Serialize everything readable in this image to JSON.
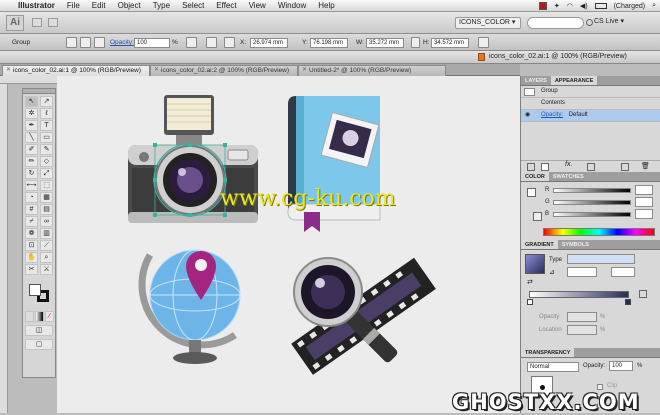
{
  "menubar": {
    "app_name": "Illustrator",
    "items": [
      "File",
      "Edit",
      "Object",
      "Type",
      "Select",
      "Effect",
      "View",
      "Window",
      "Help"
    ],
    "battery": "(Charged)"
  },
  "appbar": {
    "logo": "Ai",
    "workspace": "ICONS_COLOR ▾",
    "cs_live": "CS Live ▾"
  },
  "control": {
    "selection_label": "Group",
    "opacity_label": "Opacity:",
    "opacity_value": "100",
    "opacity_unit": "%",
    "x_label": "X:",
    "x_value": "26.974 mm",
    "y_label": "Y:",
    "y_value": "76.198 mm",
    "w_label": "W:",
    "w_value": "35.272 mm",
    "h_label": "H:",
    "h_value": "34.572 mm"
  },
  "document": {
    "title": "icons_color_02.ai:1 @ 100% (RGB/Preview)",
    "tabs": [
      {
        "label": "icons_color_02.ai:1 @ 100% (RGB/Preview)",
        "active": true
      },
      {
        "label": "icons_color_02.ai:2 @ 100% (RGB/Preview)",
        "active": false
      },
      {
        "label": "Untitled-2* @ 100% (RGB/Preview)",
        "active": false
      }
    ]
  },
  "panels": {
    "layers_tab": "LAYERS",
    "appearance_tab": "APPEARANCE",
    "appearance_rows": [
      "Group",
      "Contents"
    ],
    "appearance_opacity_label": "Opacity:",
    "appearance_opacity_value": "Default",
    "color_tab": "COLOR",
    "swatches_tab": "SWATCHES",
    "color_channels": [
      "R",
      "G",
      "B"
    ],
    "gradient_tab": "GRADIENT",
    "symbols_tab": "SYMBOLS",
    "gradient_type_label": "Type",
    "gradient_opacity_label": "Opacity",
    "gradient_location_label": "Location",
    "percent": "%",
    "transparency_tab": "TRANSPARENCY",
    "blend_mode": "Normal",
    "transparency_opacity_label": "Opacity:",
    "transparency_opacity_value": "100",
    "clip_label": "Clip"
  },
  "watermarks": {
    "center": "www.cg-ku.com",
    "corner": "GHOSTXX.COM"
  },
  "colors": {
    "selection": "#3bb0a0",
    "book_blue": "#7cc7ea",
    "pin_magenta": "#a4257f",
    "panel_highlight": "#aecbef"
  }
}
